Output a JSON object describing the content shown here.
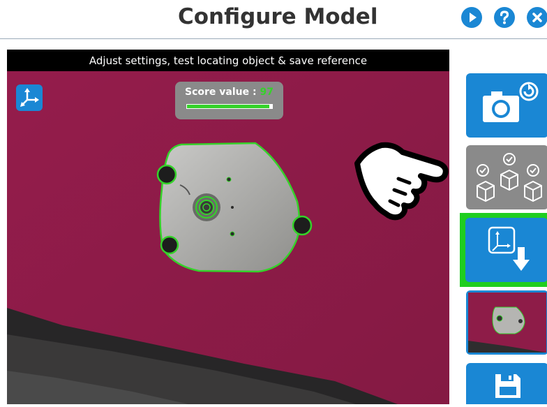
{
  "header": {
    "title": "Configure Model",
    "buttons": [
      {
        "name": "play-button",
        "glyph": "▶"
      },
      {
        "name": "help-button",
        "glyph": "?"
      },
      {
        "name": "close-button",
        "glyph": "✕"
      }
    ]
  },
  "camera": {
    "banner": "Adjust settings, test locating object & save reference",
    "score": {
      "label": "Score value :",
      "value": "97",
      "fraction": 0.97
    }
  },
  "sidebar": {
    "items": [
      {
        "name": "take-picture-button",
        "icon": "camera-refresh-icon",
        "selected": false
      },
      {
        "name": "multiple-objects-button",
        "icon": "cubes-check-icon",
        "selected": false
      },
      {
        "name": "set-reference-frame-button",
        "icon": "frame-download-icon",
        "selected": true
      },
      {
        "name": "model-thumbnail",
        "icon": "part-thumbnail",
        "selected": false
      },
      {
        "name": "save-model-button",
        "icon": "save-icon",
        "selected": false
      }
    ]
  },
  "colors": {
    "accent": "#1a87d4",
    "detection": "#35d22a",
    "surface": "#8e1c48",
    "highlight": "#1fce1f"
  }
}
